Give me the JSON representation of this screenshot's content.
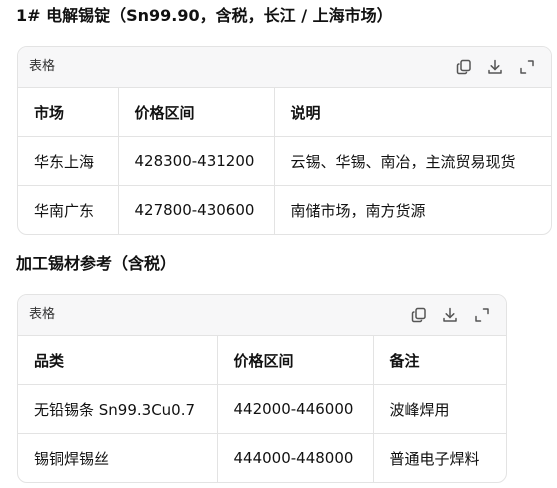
{
  "sections": [
    {
      "title": "1# 电解锡锭（Sn99.90，含税，长江 / 上海市场）",
      "table_label": "表格",
      "headers": [
        "市场",
        "价格区间",
        "说明"
      ],
      "rows": [
        [
          "华东上海",
          "428300-431200",
          "云锡、华锡、南冶，主流贸易现货"
        ],
        [
          "华南广东",
          "427800-430600",
          "南储市场，南方货源"
        ]
      ]
    },
    {
      "title": "加工锡材参考（含税）",
      "table_label": "表格",
      "headers": [
        "品类",
        "价格区间",
        "备注"
      ],
      "rows": [
        [
          "无铅锡条 Sn99.3Cu0.7",
          "442000-446000",
          "波峰焊用"
        ],
        [
          "锡铜焊锡丝",
          "444000-448000",
          "普通电子焊料"
        ]
      ]
    }
  ],
  "icons": {
    "copy": "copy-icon",
    "download": "download-icon",
    "expand": "expand-icon"
  },
  "colors": {
    "border": "#e3e3e3",
    "header_bg": "#f7f7f8",
    "icon": "#555555"
  }
}
